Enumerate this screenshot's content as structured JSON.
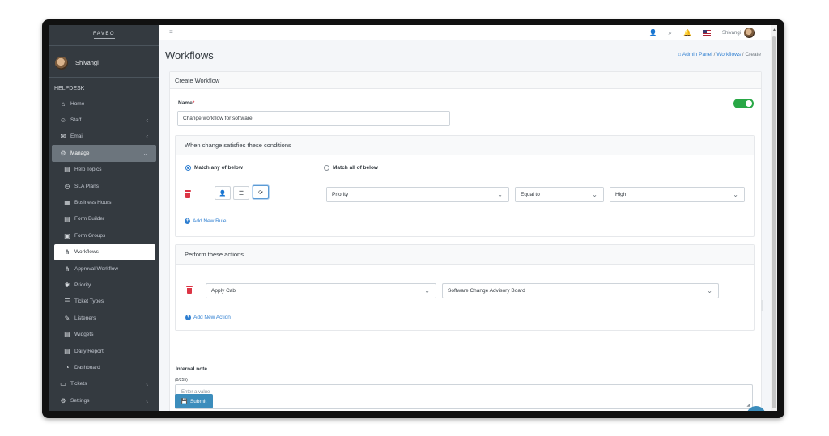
{
  "sidebar": {
    "brand": "FAVEO",
    "user": "Shivangi",
    "section": "HELPDESK",
    "items": [
      {
        "label": "Home",
        "icon": "home-icon",
        "glyph": "⌂"
      },
      {
        "label": "Staff",
        "icon": "staff-icon",
        "glyph": "☺"
      },
      {
        "label": "Email",
        "icon": "email-icon",
        "glyph": "✉"
      },
      {
        "label": "Manage",
        "icon": "manage-icon",
        "glyph": "⚙"
      },
      {
        "label": "Help Topics",
        "icon": "file-icon",
        "glyph": "▤"
      },
      {
        "label": "SLA Plans",
        "icon": "clock-icon",
        "glyph": "◷"
      },
      {
        "label": "Business Hours",
        "icon": "calendar-icon",
        "glyph": "▦"
      },
      {
        "label": "Form Builder",
        "icon": "file-icon",
        "glyph": "▤"
      },
      {
        "label": "Form Groups",
        "icon": "window-icon",
        "glyph": "▣"
      },
      {
        "label": "Workflows",
        "icon": "sitemap-icon",
        "glyph": "⋔"
      },
      {
        "label": "Approval Workflow",
        "icon": "sitemap-icon",
        "glyph": "⋔"
      },
      {
        "label": "Priority",
        "icon": "asterisk-icon",
        "glyph": "✱"
      },
      {
        "label": "Ticket Types",
        "icon": "list-icon",
        "glyph": "☰"
      },
      {
        "label": "Listeners",
        "icon": "pencil-icon",
        "glyph": "✎"
      },
      {
        "label": "Widgets",
        "icon": "widget-icon",
        "glyph": "▤"
      },
      {
        "label": "Daily Report",
        "icon": "file-icon",
        "glyph": "▤"
      },
      {
        "label": "Dashboard",
        "icon": "dashboard-icon",
        "glyph": "◔"
      },
      {
        "label": "Tickets",
        "icon": "ticket-icon",
        "glyph": "▭"
      },
      {
        "label": "Settings",
        "icon": "gear-icon",
        "glyph": "⚙"
      }
    ]
  },
  "topbar": {
    "menu_glyph": "≡",
    "user": "Shivangi",
    "icons": {
      "users": "👤",
      "search": "⌕",
      "bell": "🔔"
    }
  },
  "page": {
    "title": "Workflows",
    "breadcrumb": {
      "home": "Admin Panel",
      "sep": "/",
      "workflows": "Workflows",
      "current": "Create"
    }
  },
  "form": {
    "header": "Create Workflow",
    "name_label": "Name",
    "required_mark": "*",
    "name_value": "Change workflow for software",
    "conditions": {
      "header": "When change satisfies these conditions",
      "match_any": "Match any of below",
      "match_all": "Match all of below",
      "field": "Priority",
      "operator": "Equal to",
      "value": "High",
      "add_rule": "Add New Rule"
    },
    "actions": {
      "header": "Perform these actions",
      "action": "Apply Cab",
      "target": "Software Change Advisory Board",
      "add_action": "Add New Action"
    },
    "note": {
      "label": "Internal note",
      "counter": "(0/255)",
      "placeholder": "Enter a value"
    },
    "submit": "Submit"
  }
}
